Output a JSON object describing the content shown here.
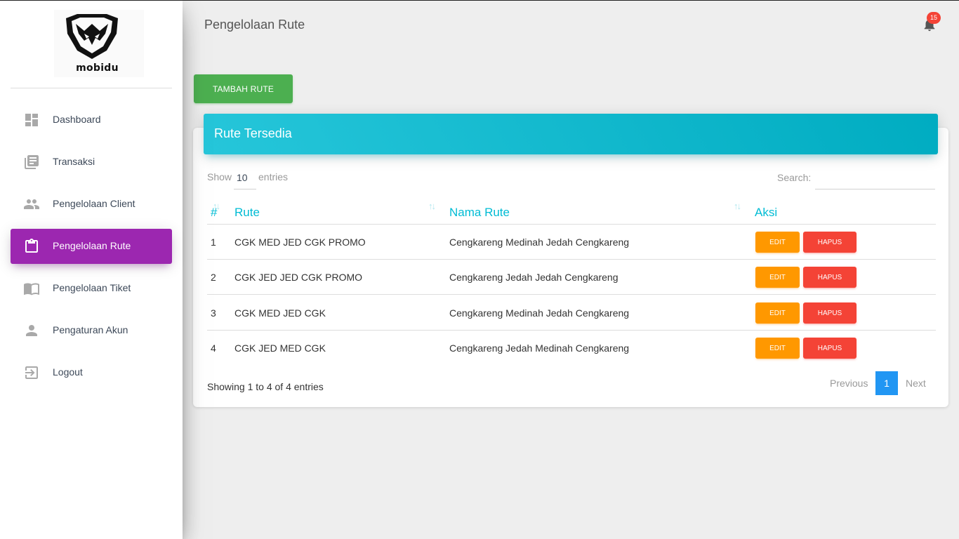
{
  "brand": {
    "name": "mobidu"
  },
  "sidebar": {
    "items": [
      {
        "label": "Dashboard",
        "icon": "dashboard-icon",
        "active": false
      },
      {
        "label": "Transaksi",
        "icon": "list-icon",
        "active": false
      },
      {
        "label": "Pengelolaan Client",
        "icon": "people-icon",
        "active": false
      },
      {
        "label": "Pengelolaan Rute",
        "icon": "clipboard-icon",
        "active": true
      },
      {
        "label": "Pengelolaan Tiket",
        "icon": "book-icon",
        "active": false
      },
      {
        "label": "Pengaturan Akun",
        "icon": "person-icon",
        "active": false
      },
      {
        "label": "Logout",
        "icon": "logout-icon",
        "active": false
      }
    ]
  },
  "header": {
    "title": "Pengelolaan Rute",
    "notifications": {
      "icon": "bell-icon",
      "count": "15"
    }
  },
  "actions": {
    "add_label": "TAMBAH RUTE"
  },
  "card": {
    "title": "Rute Tersedia",
    "length": {
      "show": "Show",
      "value": "10",
      "entries": "entries"
    },
    "search": {
      "label": "Search:",
      "value": ""
    },
    "columns": [
      "#",
      "Rute",
      "Nama Rute",
      "Aksi"
    ],
    "rows": [
      {
        "no": "1",
        "rute": "CGK MED JED CGK PROMO",
        "nama": "Cengkareng Medinah Jedah Cengkareng"
      },
      {
        "no": "2",
        "rute": "CGK JED JED CGK PROMO",
        "nama": "Cengkareng Jedah Jedah Cengkareng"
      },
      {
        "no": "3",
        "rute": "CGK MED JED CGK",
        "nama": "Cengkareng Medinah Jedah Cengkareng"
      },
      {
        "no": "4",
        "rute": "CGK JED MED CGK",
        "nama": "Cengkareng Jedah Medinah Cengkareng"
      }
    ],
    "row_actions": {
      "edit": "EDIT",
      "delete": "HAPUS"
    },
    "info": "Showing 1 to 4 of 4 entries",
    "pagination": {
      "previous": "Previous",
      "current": "1",
      "next": "Next"
    }
  },
  "colors": {
    "active_nav": "#9c27b0",
    "card_header": "#00bcd4",
    "add_button": "#4caf50",
    "edit_button": "#ff9800",
    "delete_button": "#f44336",
    "page_active": "#2196f3"
  }
}
